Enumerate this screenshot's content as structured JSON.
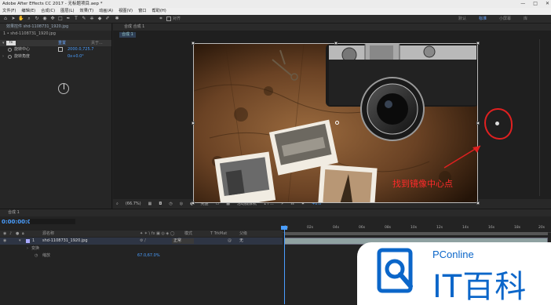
{
  "app": {
    "title": "Adobe After Effects CC 2017 - 无标题项目.aep *",
    "window_controls": [
      "—",
      "□",
      "✕"
    ]
  },
  "menu": [
    "文件(F)",
    "编辑(E)",
    "合成(C)",
    "图层(L)",
    "效果(T)",
    "动画(A)",
    "视图(V)",
    "窗口",
    "帮助(H)"
  ],
  "toolbar": {
    "snap_label": "对齐",
    "workspaces": [
      "默认",
      "标准",
      "小屏幕",
      "库"
    ]
  },
  "effect_controls": {
    "tab": "效果控件 shd-1108731_1920.jpg",
    "sub_title": "1 • shd-1108731_1920.jpg",
    "badge": "fx",
    "reset": "重置",
    "about": "关于...",
    "props": [
      {
        "label": "旋转中心",
        "value": "2000.0,725.7"
      },
      {
        "label": "旋转角度",
        "value": "0x+0.0°"
      }
    ]
  },
  "composition": {
    "tab": "合成 合成 1",
    "sub_tab": "合成 1",
    "bottom_bar": {
      "zoom": "(66.7%)",
      "quality": "完整",
      "camera": "活动摄像机",
      "views": "1个...",
      "exposure": "+0.0"
    },
    "annotation": "找到镜像中心点"
  },
  "timeline": {
    "tab": "合成 1",
    "time": "0:00:00:00",
    "columns": {
      "source_name": "源名称",
      "mode": "模式",
      "trkmat": "T TrkMat",
      "parent": "父级"
    },
    "layer": {
      "number": "1",
      "name": "shd-1108731_1920.jpg",
      "mode": "正常",
      "parent": "无"
    },
    "sub_items": [
      "变换",
      "缩放"
    ],
    "scale_value": "67.0,67.0%",
    "ruler_labels": [
      "0s",
      "02s",
      "04s",
      "06s",
      "08s",
      "10s",
      "12s",
      "14s",
      "16s",
      "18s",
      "20s"
    ]
  },
  "watermark": {
    "brand": "PConline",
    "name": "IT百科"
  },
  "colors": {
    "accent": "#4a9eff",
    "annotation_red": "#e02020",
    "watermark_blue": "#0b66c9"
  }
}
